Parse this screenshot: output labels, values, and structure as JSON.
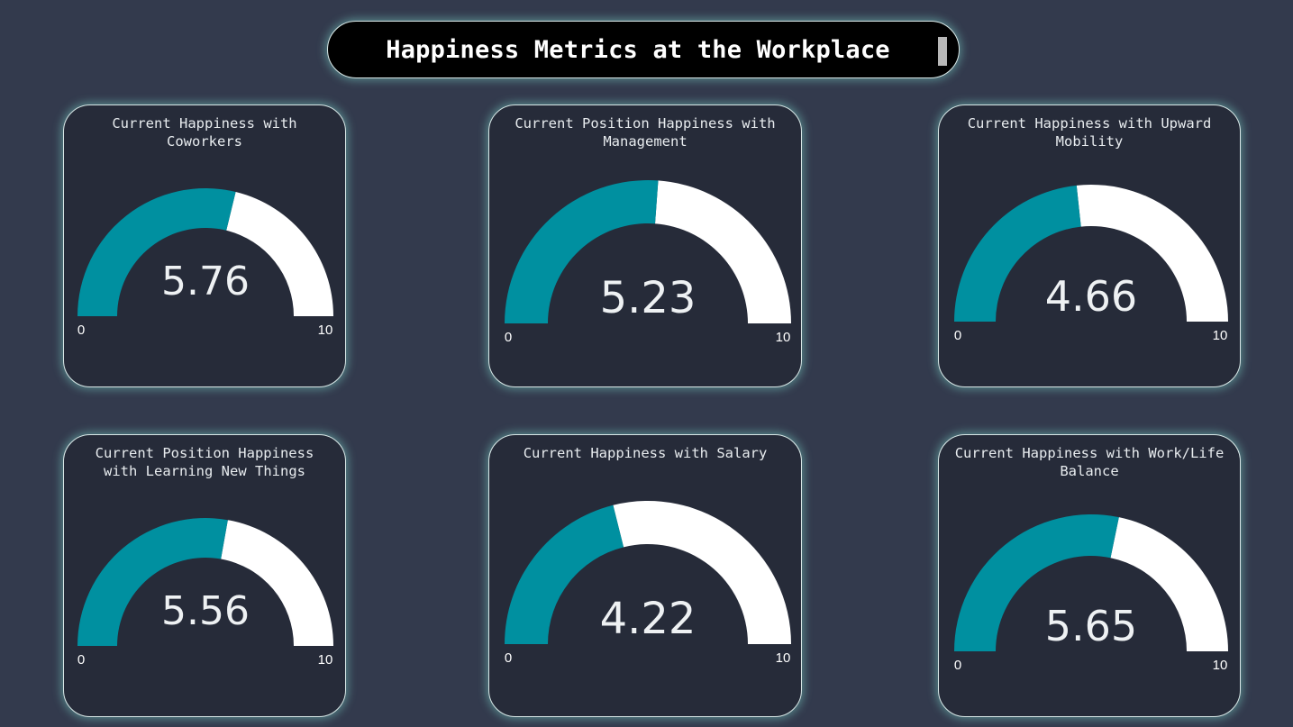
{
  "header": {
    "title": "Happiness Metrics at the Workplace"
  },
  "colors": {
    "background": "#333a4d",
    "card_background": "#262b39",
    "gauge_fill": "#0090a0",
    "gauge_track": "#ffffff",
    "glow": "#82e6d7"
  },
  "gauges": [
    {
      "title": "Current Happiness with Coworkers",
      "value": 5.76,
      "value_label": "5.76",
      "min": 0,
      "max": 10,
      "min_label": "0",
      "max_label": "10"
    },
    {
      "title": "Current Position Happiness with Management",
      "value": 5.23,
      "value_label": "5.23",
      "min": 0,
      "max": 10,
      "min_label": "0",
      "max_label": "10"
    },
    {
      "title": "Current Happiness with Upward Mobility",
      "value": 4.66,
      "value_label": "4.66",
      "min": 0,
      "max": 10,
      "min_label": "0",
      "max_label": "10"
    },
    {
      "title": "Current Position Happiness with Learning New Things",
      "value": 5.56,
      "value_label": "5.56",
      "min": 0,
      "max": 10,
      "min_label": "0",
      "max_label": "10"
    },
    {
      "title": "Current Happiness with Salary",
      "value": 4.22,
      "value_label": "4.22",
      "min": 0,
      "max": 10,
      "min_label": "0",
      "max_label": "10"
    },
    {
      "title": "Current Happiness with Work/Life Balance",
      "value": 5.65,
      "value_label": "5.65",
      "min": 0,
      "max": 10,
      "min_label": "0",
      "max_label": "10"
    }
  ]
}
